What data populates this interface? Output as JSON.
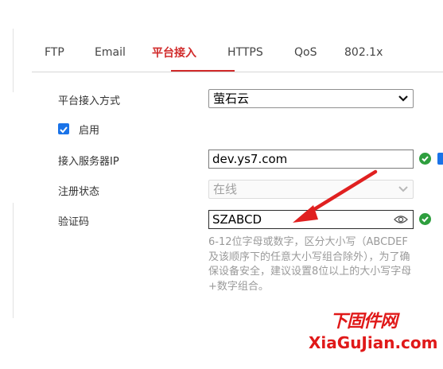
{
  "tabs": [
    {
      "label": "FTP",
      "active": false
    },
    {
      "label": "Email",
      "active": false
    },
    {
      "label": "平台接入",
      "active": true
    },
    {
      "label": "HTTPS",
      "active": false
    },
    {
      "label": "QoS",
      "active": false
    },
    {
      "label": "802.1x",
      "active": false
    }
  ],
  "form": {
    "access_mode_label": "平台接入方式",
    "access_mode_value": "萤石云",
    "enable_label": "启用",
    "enable_checked": true,
    "server_ip_label": "接入服务器IP",
    "server_ip_value": "dev.ys7.com",
    "register_status_label": "注册状态",
    "register_status_value": "在线",
    "verify_code_label": "验证码",
    "verify_code_value": "SZABCD",
    "verify_code_hint": "6-12位字母或数字，区分大小写（ABCDEF及该顺序下的任意大小写组合除外），为了确保设备安全，建议设置8位以上的大小写字母+数字组合。"
  },
  "watermark": {
    "cn": "下固件网",
    "en": "XiaGuJian.com"
  },
  "colors": {
    "accent": "#d12b2b",
    "ok": "#2e9e3e",
    "checkbox": "#1a73e8",
    "arrow": "#e02020"
  }
}
